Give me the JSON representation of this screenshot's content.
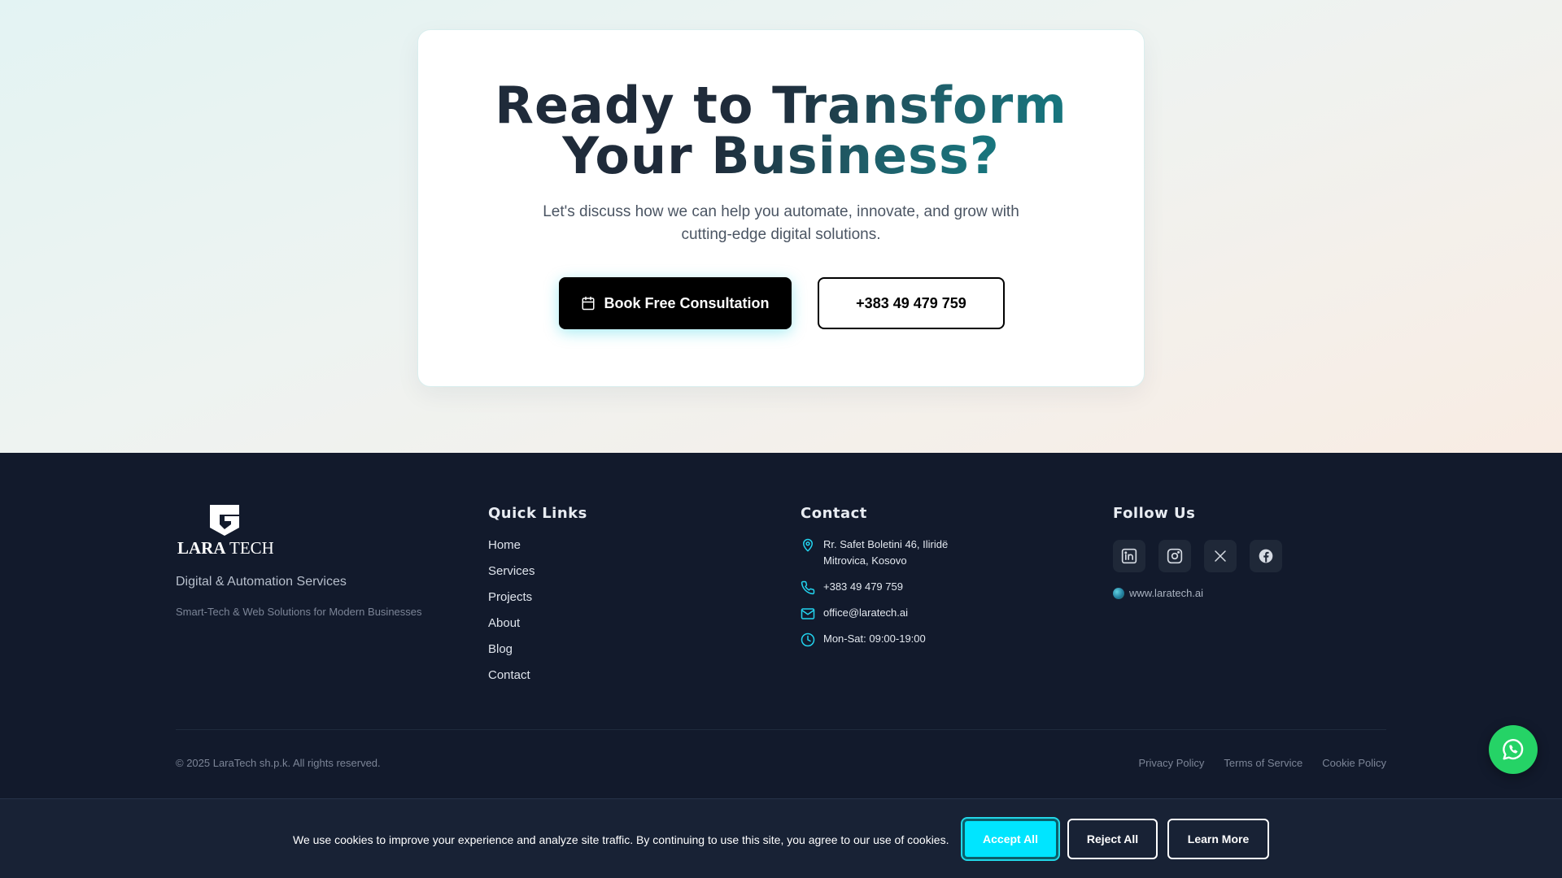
{
  "cta": {
    "title_line1_a": "Ready to ",
    "title_line1_b": "Transform",
    "title_line2_a": "Your ",
    "title_line2_b": "Business?",
    "subtitle": "Let's discuss how we can help you automate, innovate, and grow with cutting-edge digital solutions.",
    "book_button": "Book Free Consultation",
    "phone_button": "+383 49 479 759"
  },
  "brand": {
    "logo_text_a": "LARA",
    "logo_text_b": "TECH",
    "tagline": "Digital & Automation Services",
    "description": "Smart-Tech & Web Solutions for Modern Businesses"
  },
  "quick_links": {
    "heading": "Quick Links",
    "items": [
      "Home",
      "Services",
      "Projects",
      "About",
      "Blog",
      "Contact"
    ]
  },
  "contact": {
    "heading": "Contact",
    "address_line1": "Rr. Safet Boletini 46, Iliridë",
    "address_line2": "Mitrovica, Kosovo",
    "phone": "+383 49 479 759",
    "email": "office@laratech.ai",
    "hours": "Mon-Sat: 09:00-19:00"
  },
  "follow": {
    "heading": "Follow Us",
    "socials": [
      "linkedin-icon",
      "instagram-icon",
      "x-icon",
      "facebook-icon"
    ],
    "website": "www.laratech.ai"
  },
  "bottom": {
    "copyright": "© 2025 LaraTech sh.p.k. All rights reserved.",
    "privacy": "Privacy Policy",
    "terms": "Terms of Service",
    "cookie_policy": "Cookie Policy"
  },
  "cookie_banner": {
    "text": "We use cookies to improve your experience and analyze site traffic. By continuing to use this site, you agree to our use of cookies.",
    "accept": "Accept All",
    "reject": "Reject All",
    "learn_more": "Learn More"
  },
  "colors": {
    "accent": "#00e5ff",
    "footer_bg": "#121a2c",
    "whatsapp": "#25d366"
  }
}
